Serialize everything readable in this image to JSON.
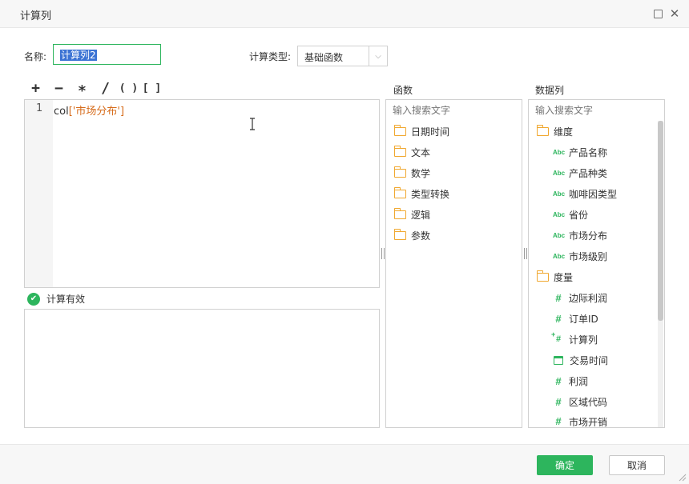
{
  "window": {
    "title": "计算列"
  },
  "form": {
    "name_label": "名称:",
    "name_value": "计算列2",
    "type_label": "计算类型:",
    "type_value": "基础函数"
  },
  "operators": [
    "+",
    "−",
    "∗",
    "/",
    "( )",
    "[ ]"
  ],
  "editor": {
    "line_number": "1",
    "code_prefix": "col",
    "code_string": "['市场分布']"
  },
  "validation": {
    "text": "计算有效"
  },
  "functions": {
    "title": "函数",
    "search_placeholder": "输入搜索文字",
    "items": [
      "日期时间",
      "文本",
      "数学",
      "类型转换",
      "逻辑",
      "参数"
    ]
  },
  "columns": {
    "title": "数据列",
    "search_placeholder": "输入搜索文字",
    "dimension_group": "维度",
    "dimensions": [
      "产品名称",
      "产品种类",
      "咖啡因类型",
      "省份",
      "市场分布",
      "市场级别"
    ],
    "measure_group": "度量",
    "measures": [
      {
        "label": "边际利润",
        "icon": "hash-icon"
      },
      {
        "label": "订单ID",
        "icon": "hash-icon"
      },
      {
        "label": "计算列",
        "icon": "calc-column-icon"
      },
      {
        "label": "交易时间",
        "icon": "date-icon"
      },
      {
        "label": "利润",
        "icon": "hash-icon"
      },
      {
        "label": "区域代码",
        "icon": "hash-icon"
      },
      {
        "label": "市场开销",
        "icon": "hash-icon"
      }
    ],
    "abc_icon_text": "Abc",
    "hash_icon_text": "#"
  },
  "footer": {
    "ok_label": "确定",
    "cancel_label": "取消"
  },
  "colors": {
    "accent": "#2db55d",
    "folder": "#f0a830",
    "string": "#d66b1a",
    "selection": "#3b73d4"
  }
}
